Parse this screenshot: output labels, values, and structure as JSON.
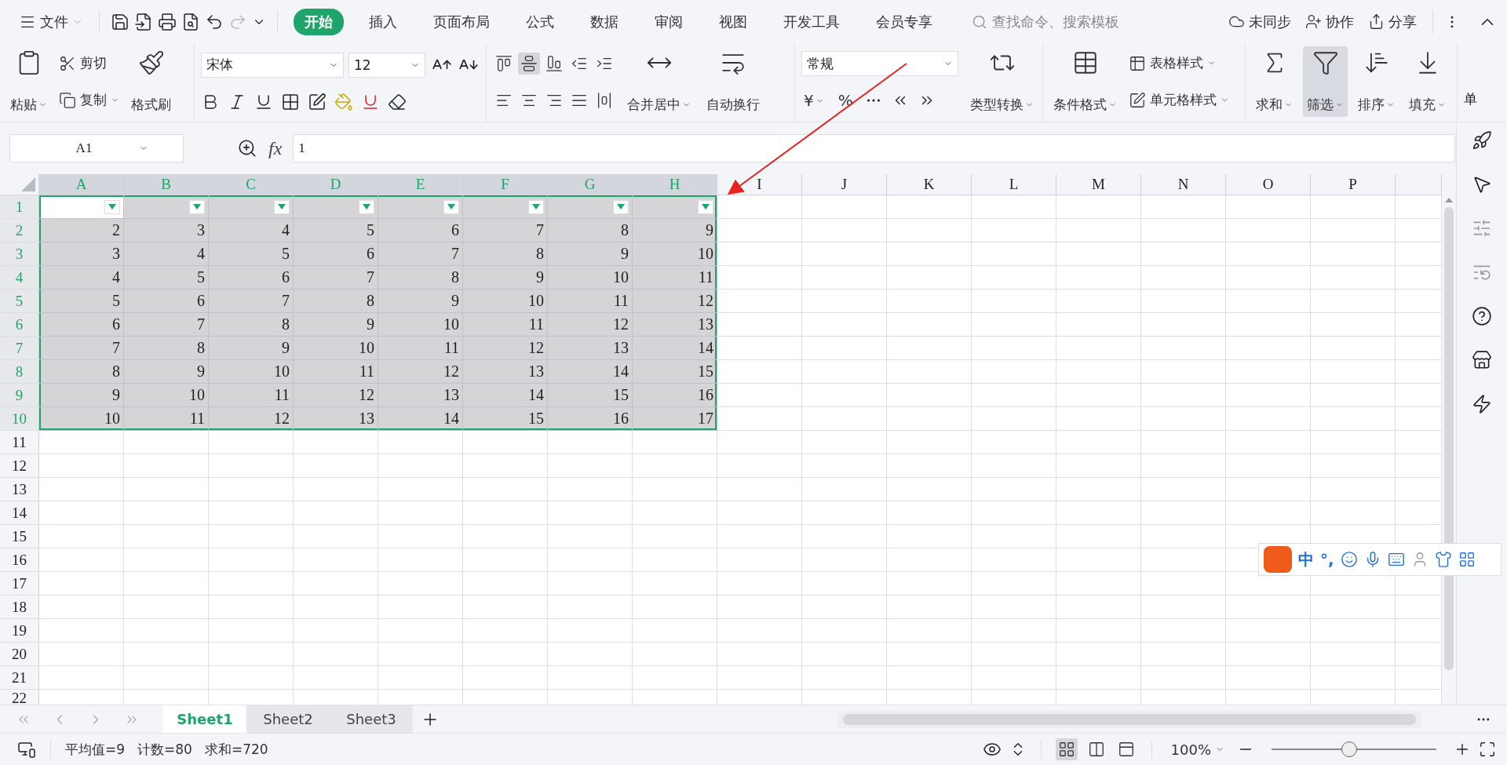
{
  "menu": {
    "file": "文件",
    "tabs": [
      {
        "label": "开始",
        "selected": true
      },
      {
        "label": "插入",
        "selected": false
      },
      {
        "label": "页面布局",
        "selected": false
      },
      {
        "label": "公式",
        "selected": false
      },
      {
        "label": "数据",
        "selected": false
      },
      {
        "label": "审阅",
        "selected": false
      },
      {
        "label": "视图",
        "selected": false
      },
      {
        "label": "开发工具",
        "selected": false
      },
      {
        "label": "会员专享",
        "selected": false
      }
    ],
    "search": {
      "placeholder": "查找命令、搜索模板"
    },
    "actions": [
      "未同步",
      "协作",
      "分享"
    ]
  },
  "ribbon": {
    "paste": "粘贴",
    "cut": "剪切",
    "copy": "复制",
    "format_painter": "格式刷",
    "font": "宋体",
    "font_size": "12",
    "align_buttons": [
      {
        "selected": false
      },
      {
        "selected": true
      },
      {
        "selected": false
      },
      {
        "selected": false
      },
      {
        "selected": false
      },
      {
        "selected": false
      },
      {
        "selected": false
      },
      {
        "selected": false
      },
      {
        "selected": false
      },
      {
        "selected": false
      }
    ],
    "merge_center": "合并居中",
    "wrap_text": "自动换行",
    "number_format": "常规",
    "currency": "¥",
    "percent": "%",
    "convert_type": "类型转换",
    "conditional_format": "条件格式",
    "table_style": "表格样式",
    "cell_style": "单元格样式",
    "sum": {
      "label": "求和",
      "selected": false
    },
    "filter": {
      "label": "筛选",
      "selected": true
    },
    "sort": {
      "label": "排序",
      "selected": false
    },
    "fill": {
      "label": "填充",
      "selected": false
    },
    "cut_off": "单"
  },
  "formula_bar": {
    "name_box": "A1",
    "fx_label": "fx",
    "formula": "1"
  },
  "sheet": {
    "autofilter": true,
    "columns": [
      {
        "letter": "A",
        "selected": true
      },
      {
        "letter": "B",
        "selected": true
      },
      {
        "letter": "C",
        "selected": true
      },
      {
        "letter": "D",
        "selected": true
      },
      {
        "letter": "E",
        "selected": true
      },
      {
        "letter": "F",
        "selected": true
      },
      {
        "letter": "G",
        "selected": true
      },
      {
        "letter": "H",
        "selected": true
      },
      {
        "letter": "I",
        "selected": false
      },
      {
        "letter": "J",
        "selected": false
      },
      {
        "letter": "K",
        "selected": false
      },
      {
        "letter": "L",
        "selected": false
      },
      {
        "letter": "M",
        "selected": false
      },
      {
        "letter": "N",
        "selected": false
      },
      {
        "letter": "O",
        "selected": false
      },
      {
        "letter": "P",
        "selected": false
      }
    ],
    "rows": [
      {
        "number": "1",
        "selected": true
      },
      {
        "number": "2",
        "selected": true,
        "cells": [
          "2",
          "3",
          "4",
          "5",
          "6",
          "7",
          "8",
          "9"
        ]
      },
      {
        "number": "3",
        "selected": true,
        "cells": [
          "3",
          "4",
          "5",
          "6",
          "7",
          "8",
          "9",
          "10"
        ]
      },
      {
        "number": "4",
        "selected": true,
        "cells": [
          "4",
          "5",
          "6",
          "7",
          "8",
          "9",
          "10",
          "11"
        ]
      },
      {
        "number": "5",
        "selected": true,
        "cells": [
          "5",
          "6",
          "7",
          "8",
          "9",
          "10",
          "11",
          "12"
        ]
      },
      {
        "number": "6",
        "selected": true,
        "cells": [
          "6",
          "7",
          "8",
          "9",
          "10",
          "11",
          "12",
          "13"
        ]
      },
      {
        "number": "7",
        "selected": true,
        "cells": [
          "7",
          "8",
          "9",
          "10",
          "11",
          "12",
          "13",
          "14"
        ]
      },
      {
        "number": "8",
        "selected": true,
        "cells": [
          "8",
          "9",
          "10",
          "11",
          "12",
          "13",
          "14",
          "15"
        ]
      },
      {
        "number": "9",
        "selected": true,
        "cells": [
          "9",
          "10",
          "11",
          "12",
          "13",
          "14",
          "15",
          "16"
        ]
      },
      {
        "number": "10",
        "selected": true,
        "cells": [
          "10",
          "11",
          "12",
          "13",
          "14",
          "15",
          "16",
          "17"
        ]
      },
      {
        "number": "11",
        "selected": false
      },
      {
        "number": "12",
        "selected": false
      },
      {
        "number": "13",
        "selected": false
      },
      {
        "number": "14",
        "selected": false
      },
      {
        "number": "15",
        "selected": false
      },
      {
        "number": "16",
        "selected": false
      },
      {
        "number": "17",
        "selected": false
      },
      {
        "number": "18",
        "selected": false
      },
      {
        "number": "19",
        "selected": false
      },
      {
        "number": "20",
        "selected": false
      },
      {
        "number": "21",
        "selected": false
      },
      {
        "number": "22",
        "selected": false
      }
    ]
  },
  "sheet_tabs": [
    {
      "label": "Sheet1",
      "selected": true
    },
    {
      "label": "Sheet2",
      "selected": false
    },
    {
      "label": "Sheet3",
      "selected": false
    }
  ],
  "status_bar": {
    "stats": [
      "平均值=9",
      "计数=80",
      "求和=720"
    ],
    "view_buttons": [
      {
        "selected": true
      },
      {
        "selected": false
      },
      {
        "selected": false
      }
    ],
    "zoom": "100%",
    "zoom_slider": {
      "level": 0.47
    }
  },
  "ime_toolbar": {
    "mode": "中",
    "punctuation": "°,"
  },
  "annotation": {
    "kind": "arrow"
  }
}
